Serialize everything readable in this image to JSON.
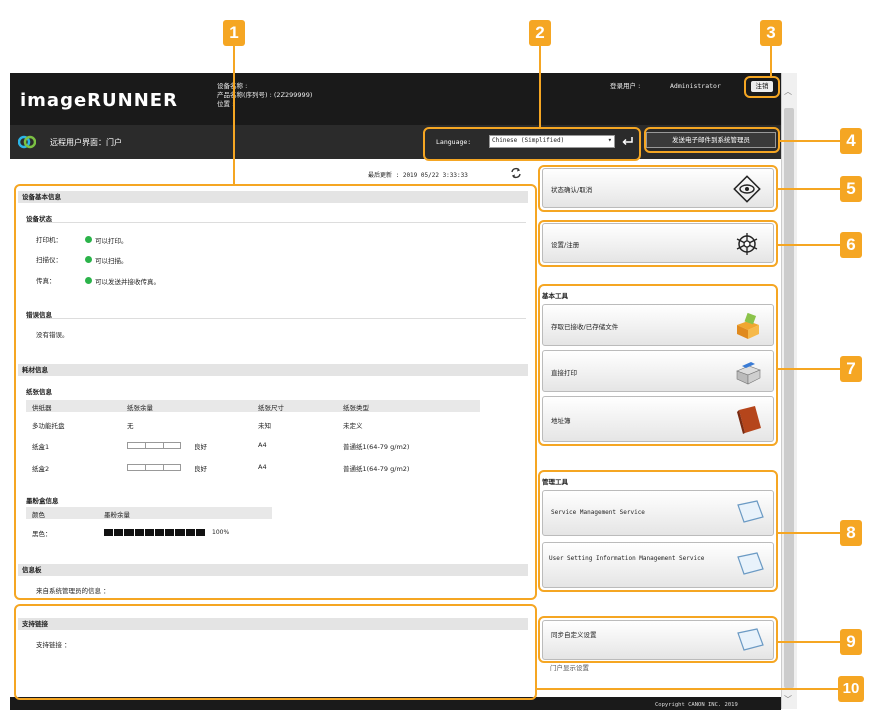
{
  "header": {
    "logo": "imageRUNNER",
    "device_name_label": "设备名称 :",
    "product_name_label": "产品名称(序列号) : (2Z299999)",
    "location_label": "位置 :",
    "login_user_label": "登录用户 :",
    "login_user": "Administrator",
    "logout_label": "注销"
  },
  "subbar": {
    "portal_title": "远程用户界面：门户",
    "language_label": "Language:",
    "language_value": "Chinese (Simplified)",
    "email_button": "发送电子邮件到系统管理员"
  },
  "last_updated": {
    "label": "最后更新 : 2019 05/22 3:33:33"
  },
  "device_info": {
    "title": "设备基本信息",
    "status_head": "设备状态",
    "status": [
      {
        "label": "打印机：",
        "value": "可以打印。"
      },
      {
        "label": "扫描仪：",
        "value": "可以扫描。"
      },
      {
        "label": "传真：",
        "value": "可以发送并接收传真。"
      }
    ],
    "error_head": "错误信息",
    "error_value": "没有错误。"
  },
  "consumables": {
    "title": "耗材信息",
    "paper_head": "纸张信息",
    "columns": [
      "供纸器",
      "纸张余量",
      "纸张尺寸",
      "纸张类型"
    ],
    "rows": [
      {
        "source": "多功能托盘",
        "remaining": "无",
        "size": "未知",
        "type": "未定义"
      },
      {
        "source": "纸盒1",
        "remaining": "良好",
        "remaining_pct": 0,
        "size": "A4",
        "type": "普通纸1(64-79 g/m2)"
      },
      {
        "source": "纸盒2",
        "remaining": "良好",
        "remaining_pct": 0,
        "size": "A4",
        "type": "普通纸1(64-79 g/m2)"
      }
    ],
    "toner_head": "墨粉盒信息",
    "toner_columns": [
      "颜色",
      "墨粉余量"
    ],
    "toner": {
      "color": "黑色：",
      "level": "100%",
      "fraction": 1.0
    }
  },
  "messages": {
    "title": "信息板",
    "text": "来自系统管理员的信息 ："
  },
  "support": {
    "title": "支持链接",
    "text": "支持链接 ："
  },
  "right": {
    "status_monitor": "状态确认/取消",
    "settings": "设置/注册",
    "basic_tools_head": "基本工具",
    "basic_tools": [
      "存取已接收/已存储文件",
      "直接打印",
      "地址簿"
    ],
    "mgmt_tools_head": "管理工具",
    "mgmt_tools": [
      "Service Management Service",
      "User Setting Information Management Service"
    ],
    "custom_menu": "同步自定义设置",
    "portal_display": "门户显示设置"
  },
  "footer": {
    "copyright": "Copyright CANON INC. 2019"
  },
  "callouts": [
    "1",
    "2",
    "3",
    "4",
    "5",
    "6",
    "7",
    "8",
    "9",
    "10"
  ],
  "colors": {
    "callout": "#f5a623",
    "status_ok": "#2bb34a",
    "header_bg": "#1a1a1a"
  },
  "icons": {
    "status_monitor": "eye-icon",
    "settings": "settings-icon",
    "received_files": "mailbox-icon",
    "direct_print": "printer-icon",
    "address_book": "book-icon",
    "mgmt_service": "monitor-icon",
    "portal": "portal-logo-icon"
  }
}
